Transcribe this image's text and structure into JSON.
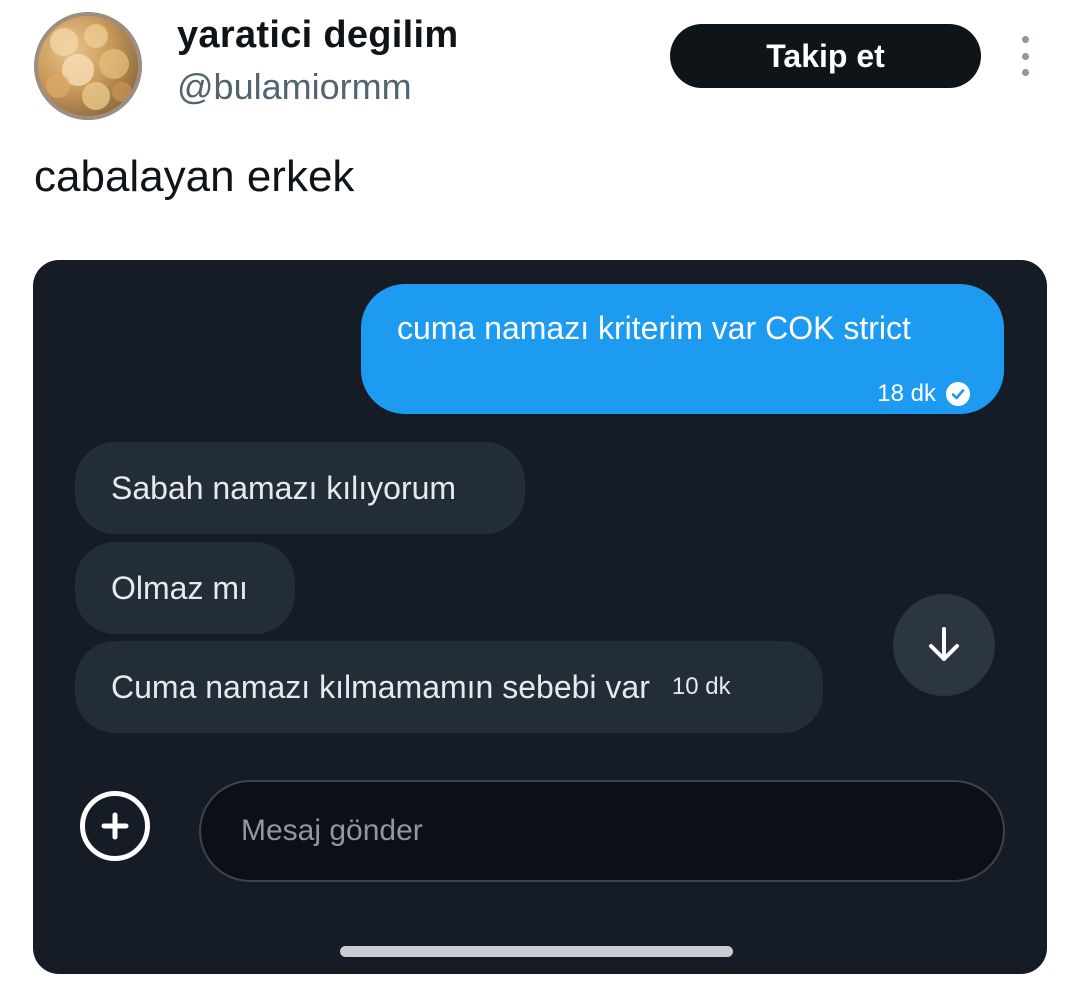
{
  "profile": {
    "display_name": "yaratici degilim",
    "handle": "@bulamiormm",
    "avatar_icon": "avatar-photo"
  },
  "header": {
    "follow_label": "Takip et",
    "more_icon": "more-vertical-icon"
  },
  "tweet": {
    "text": "cabalayan erkek"
  },
  "chat": {
    "sent_message": {
      "text": "cuma namazı kriterim var COK strict",
      "time": "18 dk",
      "status_icon": "check-circle-icon"
    },
    "received_messages": [
      {
        "text": "Sabah namazı kılıyorum"
      },
      {
        "text": "Olmaz mı"
      },
      {
        "text": "Cuma namazı kılmamamın sebebi var",
        "time": "10 dk"
      }
    ],
    "composer": {
      "placeholder": "Mesaj gönder",
      "add_icon": "plus-circle-icon"
    },
    "scroll_down_icon": "arrow-down-icon"
  },
  "colors": {
    "sent_bubble": "#1d9bf0",
    "received_bubble": "#232d38",
    "chat_background": "#151c26",
    "follow_button": "#0f1419"
  }
}
